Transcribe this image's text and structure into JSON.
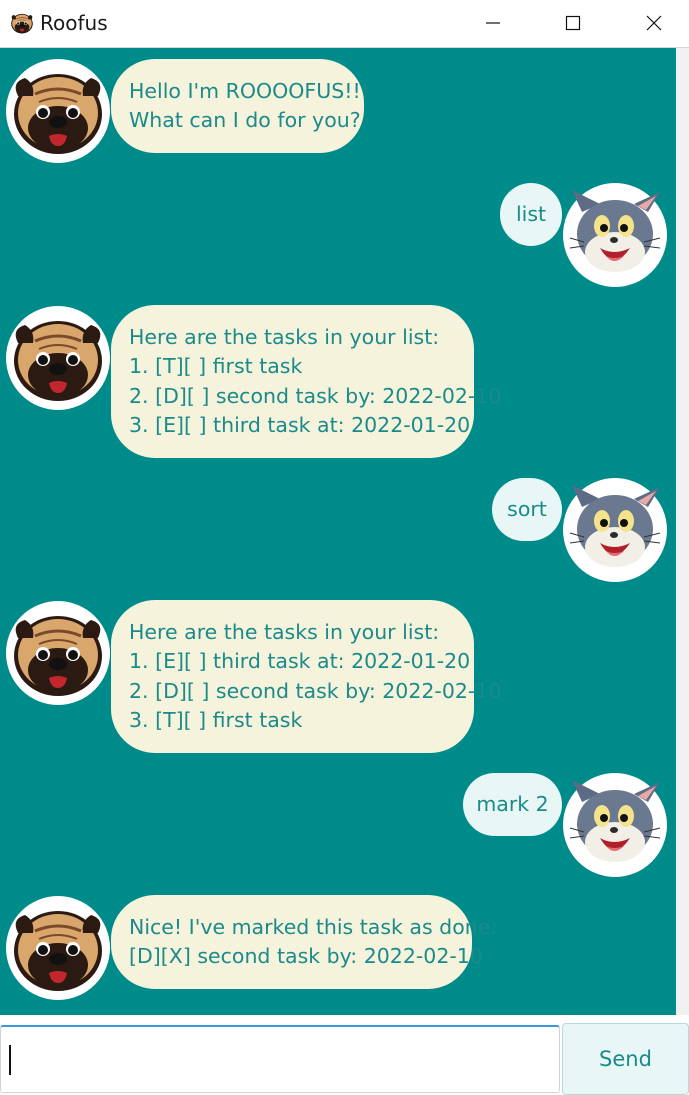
{
  "window": {
    "title": "Roofus",
    "app_icon": "pug-icon"
  },
  "colors": {
    "chat_bg": "#008b8b",
    "bot_bubble": "#f5f3dc",
    "user_bubble": "#e9f6f6",
    "text": "#1b8a8a"
  },
  "messages": [
    {
      "sender": "bot",
      "avatar": "pug-avatar",
      "lines": [
        "Hello I'm ROOOOFUS!!!",
        "What can I do for you?"
      ]
    },
    {
      "sender": "user",
      "avatar": "cat-avatar",
      "lines": [
        "list"
      ]
    },
    {
      "sender": "bot",
      "avatar": "pug-avatar",
      "lines": [
        "Here are the tasks in your list:",
        "1. [T][ ] first task",
        "2. [D][ ] second task by: 2022-02-10",
        "3. [E][ ] third task at: 2022-01-20"
      ]
    },
    {
      "sender": "user",
      "avatar": "cat-avatar",
      "lines": [
        "sort"
      ]
    },
    {
      "sender": "bot",
      "avatar": "pug-avatar",
      "lines": [
        "Here are the tasks in your list:",
        "1. [E][ ] third task at: 2022-01-20",
        "2. [D][ ] second task by: 2022-02-10",
        "3. [T][ ] first task"
      ]
    },
    {
      "sender": "user",
      "avatar": "cat-avatar",
      "lines": [
        "mark 2"
      ]
    },
    {
      "sender": "bot",
      "avatar": "pug-avatar",
      "lines": [
        "Nice! I've marked this task as done:",
        "[D][X] second task by: 2022-02-10"
      ]
    }
  ],
  "input": {
    "value": "",
    "placeholder": ""
  },
  "send_button": {
    "label": "Send"
  }
}
